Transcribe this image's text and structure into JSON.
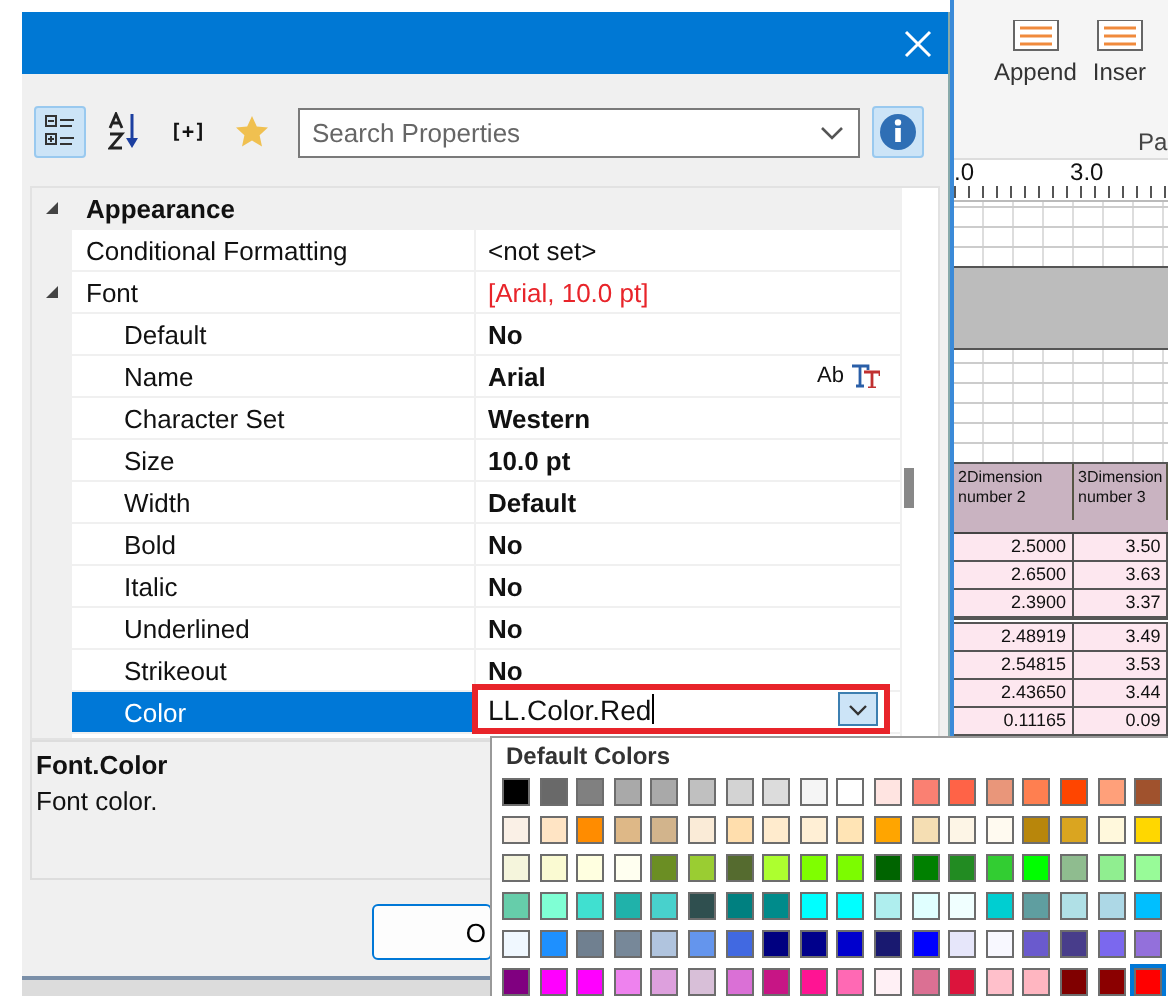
{
  "dialog": {
    "toolbar": {
      "buttons": [
        {
          "kind": "categorized",
          "selected": true
        },
        {
          "kind": "alphabetical",
          "selected": false
        },
        {
          "kind": "text",
          "label": "[+]",
          "selected": false
        },
        {
          "kind": "favorites",
          "selected": false
        }
      ],
      "search": {
        "placeholder": "Search Properties"
      },
      "info": {
        "selected": true
      }
    },
    "properties": [
      {
        "name": "Appearance",
        "expanded": true,
        "selected": false,
        "children": [
          {
            "name": "Conditional Formatting",
            "value": "<not set>",
            "selected": false
          },
          {
            "name": "Font",
            "value": "[Arial, 10.0 pt]",
            "changed": true,
            "expanded": true,
            "selected": false,
            "children": [
              {
                "name": "Default",
                "value": "No",
                "selected": false
              },
              {
                "name": "Name",
                "value": "Arial",
                "preview": "Ab",
                "selected": false
              },
              {
                "name": "Character Set",
                "value": "Western",
                "selected": false
              },
              {
                "name": "Size",
                "value": "10.0 pt",
                "selected": false
              },
              {
                "name": "Width",
                "value": "Default",
                "selected": false
              },
              {
                "name": "Bold",
                "value": "No",
                "selected": false
              },
              {
                "name": "Italic",
                "value": "No",
                "selected": false
              },
              {
                "name": "Underlined",
                "value": "No",
                "selected": false
              },
              {
                "name": "Strikeout",
                "value": "No",
                "selected": false
              },
              {
                "name": "Color",
                "value": "LL.Color.Red",
                "selected": true
              }
            ]
          }
        ]
      }
    ],
    "description": {
      "title": "Font.Color",
      "text": "Font color."
    },
    "buttons": [
      {
        "label": "O"
      }
    ]
  },
  "color_palette": {
    "title": "Default Colors",
    "rows": [
      [
        {
          "color": "#000000",
          "selected": false
        },
        {
          "color": "#696969",
          "selected": false
        },
        {
          "color": "#808080",
          "selected": false
        },
        {
          "color": "#a9a9a9",
          "selected": false
        },
        {
          "color": "#a9a9a9",
          "selected": false
        },
        {
          "color": "#c0c0c0",
          "selected": false
        },
        {
          "color": "#d3d3d3",
          "selected": false
        },
        {
          "color": "#dcdcdc",
          "selected": false
        },
        {
          "color": "#f5f5f5",
          "selected": false
        },
        {
          "color": "#ffffff",
          "selected": false
        },
        {
          "color": "#ffe4e1",
          "selected": false
        },
        {
          "color": "#fa8072",
          "selected": false
        },
        {
          "color": "#ff6347",
          "selected": false
        },
        {
          "color": "#e9967a",
          "selected": false
        },
        {
          "color": "#ff7f50",
          "selected": false
        },
        {
          "color": "#ff4500",
          "selected": false
        },
        {
          "color": "#ffa07a",
          "selected": false
        },
        {
          "color": "#a0522d",
          "selected": false
        }
      ],
      [
        {
          "color": "#faf0e6",
          "selected": false
        },
        {
          "color": "#ffe4c4",
          "selected": false
        },
        {
          "color": "#ff8c00",
          "selected": false
        },
        {
          "color": "#deb887",
          "selected": false
        },
        {
          "color": "#d2b48c",
          "selected": false
        },
        {
          "color": "#faebd7",
          "selected": false
        },
        {
          "color": "#ffdead",
          "selected": false
        },
        {
          "color": "#ffebcd",
          "selected": false
        },
        {
          "color": "#ffefd5",
          "selected": false
        },
        {
          "color": "#ffe4b5",
          "selected": false
        },
        {
          "color": "#ffa500",
          "selected": false
        },
        {
          "color": "#f5deb3",
          "selected": false
        },
        {
          "color": "#fdf5e6",
          "selected": false
        },
        {
          "color": "#fffaf0",
          "selected": false
        },
        {
          "color": "#b8860b",
          "selected": false
        },
        {
          "color": "#daa520",
          "selected": false
        },
        {
          "color": "#fff8dc",
          "selected": false
        },
        {
          "color": "#ffd700",
          "selected": false
        }
      ],
      [
        {
          "color": "#f5f5dc",
          "selected": false
        },
        {
          "color": "#fafad2",
          "selected": false
        },
        {
          "color": "#ffffe0",
          "selected": false
        },
        {
          "color": "#fffff0",
          "selected": false
        },
        {
          "color": "#6b8e23",
          "selected": false
        },
        {
          "color": "#9acd32",
          "selected": false
        },
        {
          "color": "#556b2f",
          "selected": false
        },
        {
          "color": "#adff2f",
          "selected": false
        },
        {
          "color": "#7fff00",
          "selected": false
        },
        {
          "color": "#7cfc00",
          "selected": false
        },
        {
          "color": "#006400",
          "selected": false
        },
        {
          "color": "#008000",
          "selected": false
        },
        {
          "color": "#228b22",
          "selected": false
        },
        {
          "color": "#32cd32",
          "selected": false
        },
        {
          "color": "#00ff00",
          "selected": false
        },
        {
          "color": "#8fbc8f",
          "selected": false
        },
        {
          "color": "#90ee90",
          "selected": false
        },
        {
          "color": "#98fb98",
          "selected": false
        }
      ],
      [
        {
          "color": "#66cdaa",
          "selected": false
        },
        {
          "color": "#7fffd4",
          "selected": false
        },
        {
          "color": "#40e0d0",
          "selected": false
        },
        {
          "color": "#20b2aa",
          "selected": false
        },
        {
          "color": "#48d1cc",
          "selected": false
        },
        {
          "color": "#2f4f4f",
          "selected": false
        },
        {
          "color": "#008080",
          "selected": false
        },
        {
          "color": "#008b8b",
          "selected": false
        },
        {
          "color": "#00ffff",
          "selected": false
        },
        {
          "color": "#00ffff",
          "selected": false
        },
        {
          "color": "#afeeee",
          "selected": false
        },
        {
          "color": "#e0ffff",
          "selected": false
        },
        {
          "color": "#f0ffff",
          "selected": false
        },
        {
          "color": "#00ced1",
          "selected": false
        },
        {
          "color": "#5f9ea0",
          "selected": false
        },
        {
          "color": "#b0e0e6",
          "selected": false
        },
        {
          "color": "#add8e6",
          "selected": false
        },
        {
          "color": "#00bfff",
          "selected": false
        }
      ],
      [
        {
          "color": "#f0f8ff",
          "selected": false
        },
        {
          "color": "#1e90ff",
          "selected": false
        },
        {
          "color": "#708090",
          "selected": false
        },
        {
          "color": "#778899",
          "selected": false
        },
        {
          "color": "#b0c4de",
          "selected": false
        },
        {
          "color": "#6495ed",
          "selected": false
        },
        {
          "color": "#4169e1",
          "selected": false
        },
        {
          "color": "#000080",
          "selected": false
        },
        {
          "color": "#00008b",
          "selected": false
        },
        {
          "color": "#0000cd",
          "selected": false
        },
        {
          "color": "#191970",
          "selected": false
        },
        {
          "color": "#0000ff",
          "selected": false
        },
        {
          "color": "#e6e6fa",
          "selected": false
        },
        {
          "color": "#f8f8ff",
          "selected": false
        },
        {
          "color": "#6a5acd",
          "selected": false
        },
        {
          "color": "#483d8b",
          "selected": false
        },
        {
          "color": "#7b68ee",
          "selected": false
        },
        {
          "color": "#9370db",
          "selected": false
        }
      ],
      [
        {
          "color": "#800080",
          "selected": false
        },
        {
          "color": "#ff00ff",
          "selected": false
        },
        {
          "color": "#ff00ff",
          "selected": false
        },
        {
          "color": "#ee82ee",
          "selected": false
        },
        {
          "color": "#dda0dd",
          "selected": false
        },
        {
          "color": "#d8bfd8",
          "selected": false
        },
        {
          "color": "#da70d6",
          "selected": false
        },
        {
          "color": "#c71585",
          "selected": false
        },
        {
          "color": "#ff1493",
          "selected": false
        },
        {
          "color": "#ff69b4",
          "selected": false
        },
        {
          "color": "#fff0f5",
          "selected": false
        },
        {
          "color": "#db7093",
          "selected": false
        },
        {
          "color": "#dc143c",
          "selected": false
        },
        {
          "color": "#ffc0cb",
          "selected": false
        },
        {
          "color": "#ffb6c1",
          "selected": false
        },
        {
          "color": "#800000",
          "selected": false
        },
        {
          "color": "#8b0000",
          "selected": false
        },
        {
          "color": "#ff0000",
          "selected": true
        }
      ]
    ]
  },
  "background_window": {
    "ribbon": {
      "buttons": [
        {
          "label": "Append"
        },
        {
          "label": "Inser"
        }
      ],
      "group_label": "Pa"
    },
    "ruler": {
      "labels": [
        ".0",
        "3.0"
      ]
    },
    "table": {
      "headers": [
        "2Dimension number 2",
        "3Dimension number 3"
      ],
      "groups": [
        [
          [
            "2.5000",
            "3.50"
          ],
          [
            "2.6500",
            "3.63"
          ],
          [
            "2.3900",
            "3.37"
          ]
        ],
        [
          [
            "2.48919",
            "3.49"
          ],
          [
            "2.54815",
            "3.53"
          ],
          [
            "2.43650",
            "3.44"
          ],
          [
            "0.11165",
            "0.09"
          ]
        ]
      ]
    }
  }
}
